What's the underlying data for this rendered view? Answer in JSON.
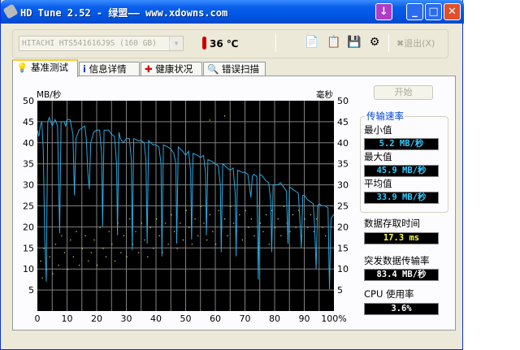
{
  "window": {
    "title": "HD Tune 2.52 - 绿盟—— www.xdowns.com"
  },
  "toolbar": {
    "drive": "HITACHI HTS541616J9S (160 GB)",
    "temperature": "36",
    "temp_unit": "℃",
    "exit_label": "退出(X)"
  },
  "tabs": [
    {
      "label": "基准测试",
      "icon": "lightbulb-icon"
    },
    {
      "label": "信息详情",
      "icon": "info-icon"
    },
    {
      "label": "健康状况",
      "icon": "health-cross-icon"
    },
    {
      "label": "错误扫描",
      "icon": "magnifier-icon"
    }
  ],
  "side": {
    "start": "开始",
    "group_title": "传输速率",
    "min_label": "最小值",
    "min": "5.2 MB/秒",
    "max_label": "最大值",
    "max": "45.9 MB/秒",
    "avg_label": "平均值",
    "avg": "33.9 MB/秒",
    "access_label": "数据存取时间",
    "access": "17.3 ms",
    "burst_label": "突发数据传输率",
    "burst": "83.4 MB/秒",
    "cpu_label": "CPU 使用率",
    "cpu": "3.6%"
  },
  "colors": {
    "transfer": "#2BA8E0",
    "access": "#E8E860",
    "grid": "#808080",
    "bg": "#000000",
    "value_blue": "#33CCFF",
    "value_yellow": "#FFFF40"
  },
  "chart_data": {
    "type": "line",
    "ylabel_left": "MB/秒",
    "ylabel_right": "毫秒",
    "xlim": [
      0,
      100
    ],
    "ylim": [
      0,
      50
    ],
    "ylim_right": [
      0,
      50
    ],
    "x_ticks": [
      "0",
      "10",
      "20",
      "30",
      "40",
      "50",
      "60",
      "70",
      "80",
      "90",
      "100%"
    ],
    "y_ticks": [
      "5",
      "10",
      "15",
      "20",
      "25",
      "30",
      "35",
      "40",
      "45",
      "50"
    ],
    "grid": true,
    "transfer_rate": [
      [
        0,
        43
      ],
      [
        0.5,
        41.5
      ],
      [
        1,
        44
      ],
      [
        1.5,
        45
      ],
      [
        2,
        38
      ],
      [
        2.5,
        17
      ],
      [
        3,
        7
      ],
      [
        3.5,
        45
      ],
      [
        4,
        46
      ],
      [
        5,
        44
      ],
      [
        6,
        45.5
      ],
      [
        6.8,
        44
      ],
      [
        7.5,
        18.5
      ],
      [
        8,
        45
      ],
      [
        9,
        45
      ],
      [
        9.5,
        44
      ],
      [
        10,
        45.5
      ],
      [
        11,
        45.5
      ],
      [
        12,
        42
      ],
      [
        12.5,
        27.5
      ],
      [
        13,
        41
      ],
      [
        14,
        43
      ],
      [
        15,
        43.5
      ],
      [
        16,
        44
      ],
      [
        16.5,
        41
      ],
      [
        17,
        33
      ],
      [
        17.5,
        29
      ],
      [
        18,
        40
      ],
      [
        19,
        42.5
      ],
      [
        20,
        43
      ],
      [
        21,
        43
      ],
      [
        21.7,
        37
      ],
      [
        22,
        20
      ],
      [
        22.5,
        43
      ],
      [
        24,
        43
      ],
      [
        25,
        42
      ],
      [
        26,
        41.5
      ],
      [
        26.7,
        35
      ],
      [
        27,
        18
      ],
      [
        27.5,
        42.5
      ],
      [
        28,
        41
      ],
      [
        29,
        40
      ],
      [
        30,
        41
      ],
      [
        31,
        41
      ],
      [
        31.7,
        36
      ],
      [
        32,
        14.5
      ],
      [
        32.5,
        41
      ],
      [
        34,
        40.5
      ],
      [
        35,
        40.5
      ],
      [
        36,
        40
      ],
      [
        36.6,
        36
      ],
      [
        37,
        16
      ],
      [
        37.5,
        40.5
      ],
      [
        39,
        39.5
      ],
      [
        40,
        39.5
      ],
      [
        41,
        39
      ],
      [
        41.7,
        35
      ],
      [
        42,
        13
      ],
      [
        42.5,
        39.5
      ],
      [
        44,
        39
      ],
      [
        45,
        38.5
      ],
      [
        46,
        37.5
      ],
      [
        46.7,
        35
      ],
      [
        47,
        16
      ],
      [
        47.5,
        39
      ],
      [
        49,
        38
      ],
      [
        50,
        37
      ],
      [
        51,
        38
      ],
      [
        51.7,
        33
      ],
      [
        52,
        17
      ],
      [
        52.5,
        37.5
      ],
      [
        54,
        37
      ],
      [
        55,
        36.5
      ],
      [
        56,
        37
      ],
      [
        56.7,
        33
      ],
      [
        57,
        18
      ],
      [
        57.5,
        36
      ],
      [
        59,
        35.5
      ],
      [
        60,
        35
      ],
      [
        61,
        34.5
      ],
      [
        61.7,
        30
      ],
      [
        62,
        14
      ],
      [
        62.5,
        35
      ],
      [
        64,
        34
      ],
      [
        65,
        33.5
      ],
      [
        66,
        34
      ],
      [
        66.7,
        28
      ],
      [
        67,
        13
      ],
      [
        67.5,
        33.5
      ],
      [
        69,
        33
      ],
      [
        70,
        33
      ],
      [
        71,
        32.5
      ],
      [
        72,
        27
      ],
      [
        72.5,
        32
      ],
      [
        73,
        32.5
      ],
      [
        74,
        32
      ],
      [
        74.5,
        7.5
      ],
      [
        75,
        32.5
      ],
      [
        76,
        32
      ],
      [
        77,
        31
      ],
      [
        78,
        30.5
      ],
      [
        78.7,
        26
      ],
      [
        79,
        14
      ],
      [
        79.5,
        30
      ],
      [
        81,
        30
      ],
      [
        82,
        30.5
      ],
      [
        83,
        29.5
      ],
      [
        84,
        28.5
      ],
      [
        84.5,
        16
      ],
      [
        85,
        29.5
      ],
      [
        86,
        29
      ],
      [
        87,
        28.5
      ],
      [
        88,
        28
      ],
      [
        88.5,
        22
      ],
      [
        89,
        15
      ],
      [
        89.5,
        27.5
      ],
      [
        90,
        27.5
      ],
      [
        91,
        26.5
      ],
      [
        92,
        26
      ],
      [
        93,
        25.5
      ],
      [
        93.5,
        20
      ],
      [
        94,
        10
      ],
      [
        94.5,
        25
      ],
      [
        95,
        25.5
      ],
      [
        96,
        25
      ],
      [
        97,
        25
      ],
      [
        98,
        24.5
      ],
      [
        98.5,
        5.2
      ],
      [
        99,
        22
      ],
      [
        100,
        23
      ]
    ],
    "access_time_ms": [
      [
        1,
        12
      ],
      [
        1.5,
        8
      ],
      [
        2,
        15
      ],
      [
        3,
        10
      ],
      [
        4,
        13
      ],
      [
        5,
        9
      ],
      [
        6,
        16
      ],
      [
        7,
        11
      ],
      [
        8,
        18
      ],
      [
        9,
        14
      ],
      [
        10,
        10
      ],
      [
        11,
        17
      ],
      [
        12,
        13
      ],
      [
        13,
        19
      ],
      [
        14,
        11
      ],
      [
        15,
        15
      ],
      [
        16,
        18
      ],
      [
        17,
        12
      ],
      [
        18,
        14
      ],
      [
        19,
        17
      ],
      [
        20,
        11
      ],
      [
        21,
        20
      ],
      [
        22,
        15
      ],
      [
        23,
        13
      ],
      [
        24,
        19
      ],
      [
        25,
        16
      ],
      [
        26,
        12
      ],
      [
        27,
        21
      ],
      [
        28,
        14
      ],
      [
        29,
        18
      ],
      [
        30,
        13
      ],
      [
        31,
        22
      ],
      [
        32,
        16
      ],
      [
        33,
        19
      ],
      [
        34,
        14
      ],
      [
        35,
        21
      ],
      [
        36,
        17
      ],
      [
        37,
        13
      ],
      [
        38,
        20
      ],
      [
        39,
        15
      ],
      [
        40,
        22
      ],
      [
        41,
        18
      ],
      [
        42,
        14
      ],
      [
        43,
        21
      ],
      [
        44,
        16
      ],
      [
        45,
        23
      ],
      [
        46,
        19
      ],
      [
        47,
        15
      ],
      [
        48,
        21
      ],
      [
        49,
        17
      ],
      [
        50,
        24
      ],
      [
        51,
        20
      ],
      [
        52,
        16
      ],
      [
        53,
        22
      ],
      [
        54,
        18
      ],
      [
        55,
        25
      ],
      [
        56,
        21
      ],
      [
        57,
        17
      ],
      [
        58,
        23
      ],
      [
        59,
        19
      ],
      [
        60,
        16
      ],
      [
        61,
        24
      ],
      [
        62,
        20
      ],
      [
        63,
        22
      ],
      [
        64,
        18
      ],
      [
        65,
        25
      ],
      [
        66,
        21
      ],
      [
        67,
        19
      ],
      [
        68,
        23
      ],
      [
        69,
        17
      ],
      [
        70,
        24
      ],
      [
        71,
        20
      ],
      [
        72,
        22
      ],
      [
        73,
        18
      ],
      [
        74,
        25
      ],
      [
        75,
        21
      ],
      [
        76,
        19
      ],
      [
        77,
        23
      ],
      [
        78,
        16
      ],
      [
        79,
        24
      ],
      [
        80,
        20
      ],
      [
        81,
        22
      ],
      [
        82,
        18
      ],
      [
        83,
        25
      ],
      [
        84,
        21
      ],
      [
        85,
        19
      ],
      [
        86,
        23
      ],
      [
        87,
        20
      ],
      [
        88,
        24
      ],
      [
        89,
        18
      ],
      [
        90,
        22
      ],
      [
        91,
        20
      ],
      [
        92,
        23
      ],
      [
        93,
        19
      ],
      [
        94,
        22
      ],
      [
        96,
        20
      ],
      [
        97,
        18
      ],
      [
        58,
        45.5
      ],
      [
        63,
        46.5
      ]
    ]
  }
}
